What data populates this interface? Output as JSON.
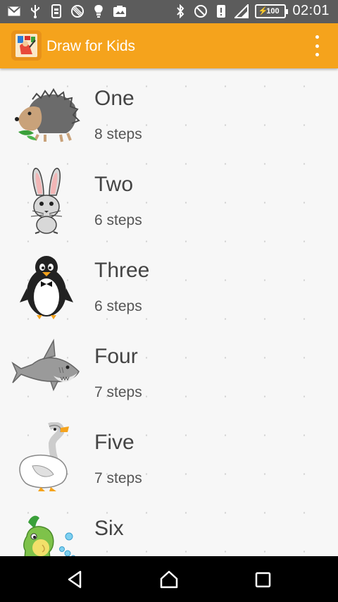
{
  "status_bar": {
    "time": "02:01",
    "battery": "100",
    "icons": [
      "gmail-icon",
      "usb-icon",
      "sim-toolkit-icon",
      "blocked-icon",
      "bulb-icon",
      "photo-icon",
      "bluetooth-icon",
      "do-not-disturb-icon",
      "silent-icon",
      "signal-icon",
      "battery-charging-icon"
    ]
  },
  "app_bar": {
    "title": "Draw for Kids",
    "menu_icon": "overflow-menu-icon"
  },
  "lessons": [
    {
      "title": "One",
      "steps": "8 steps",
      "icon": "hedgehog-drawing"
    },
    {
      "title": "Two",
      "steps": "6 steps",
      "icon": "rabbit-drawing"
    },
    {
      "title": "Three",
      "steps": "6 steps",
      "icon": "penguin-drawing"
    },
    {
      "title": "Four",
      "steps": "7 steps",
      "icon": "shark-drawing"
    },
    {
      "title": "Five",
      "steps": "7 steps",
      "icon": "goose-drawing"
    },
    {
      "title": "Six",
      "steps": "",
      "icon": "fish-drawing"
    }
  ],
  "nav_bar": {
    "icons": [
      "back-icon",
      "home-icon",
      "recents-icon"
    ]
  },
  "colors": {
    "app_bar": "#f5a31c",
    "status_bar": "#5c5c5c",
    "background": "#f7f7f7"
  }
}
